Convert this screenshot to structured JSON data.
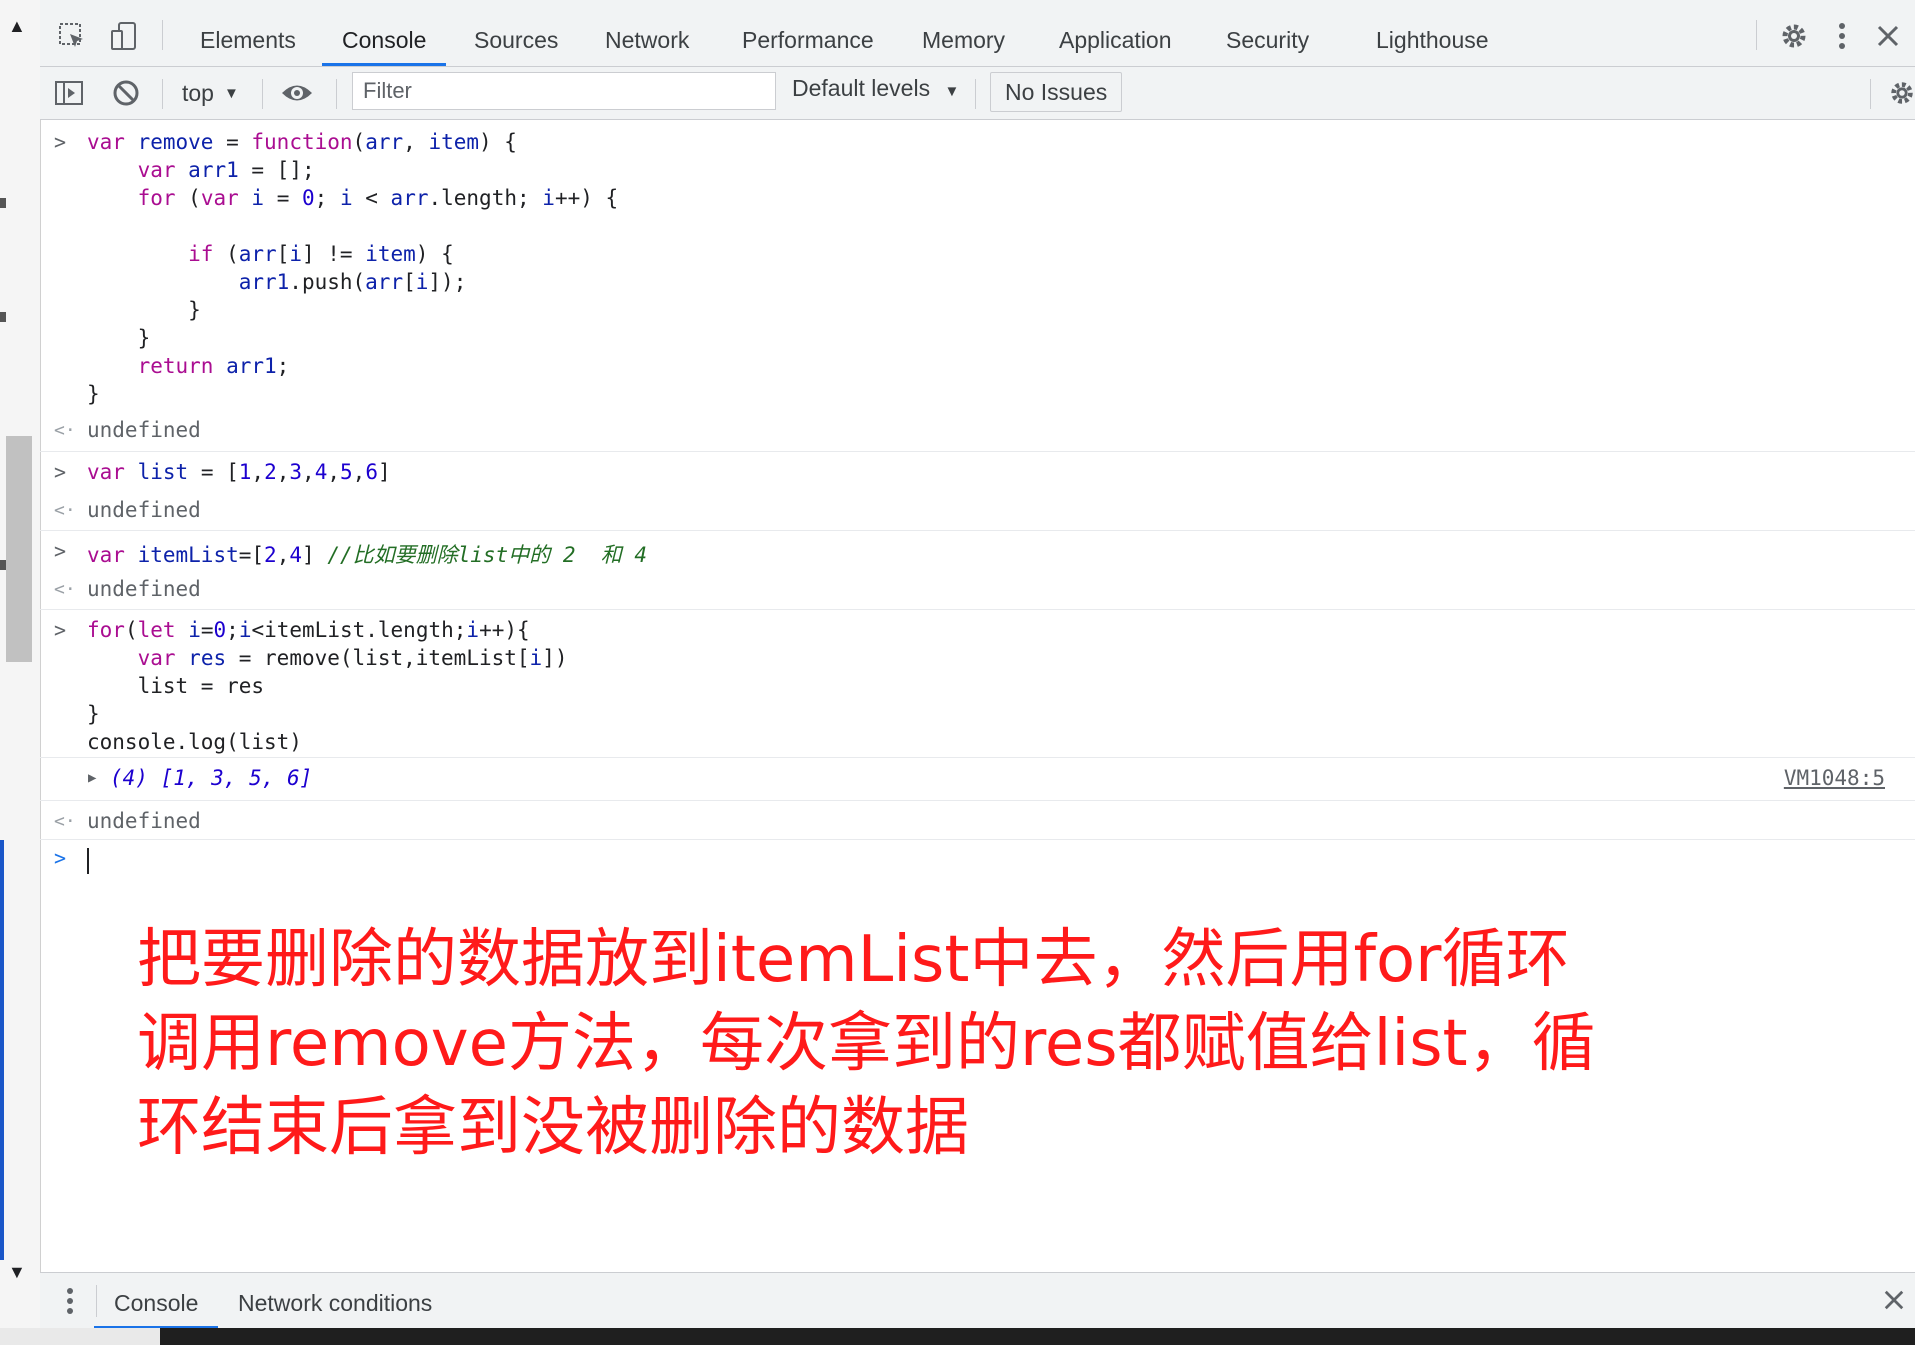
{
  "tabs": [
    "Elements",
    "Console",
    "Sources",
    "Network",
    "Performance",
    "Memory",
    "Application",
    "Security",
    "Lighthouse"
  ],
  "active_tab": "Console",
  "toolbar": {
    "context": "top",
    "filter_placeholder": "Filter",
    "levels": "Default levels",
    "issues": "No Issues"
  },
  "console": {
    "undefined_label": "undefined",
    "log_result": "(4) [1, 3, 5, 6]",
    "log_source": "VM1048:5"
  },
  "annotation": {
    "line1": "把要删除的数据放到itemList中去，然后用for循环",
    "line2": "调用remove方法，每次拿到的res都赋值给list，循",
    "line3": "环结束后拿到没被删除的数据"
  },
  "drawer": {
    "tabs": [
      "Console",
      "Network conditions"
    ]
  },
  "colors": {
    "accent": "#1a73e8",
    "annotation": "#ff1a1a",
    "keyword": "#aa0d91",
    "variable": "#1c00cf",
    "comment": "#236e25"
  }
}
